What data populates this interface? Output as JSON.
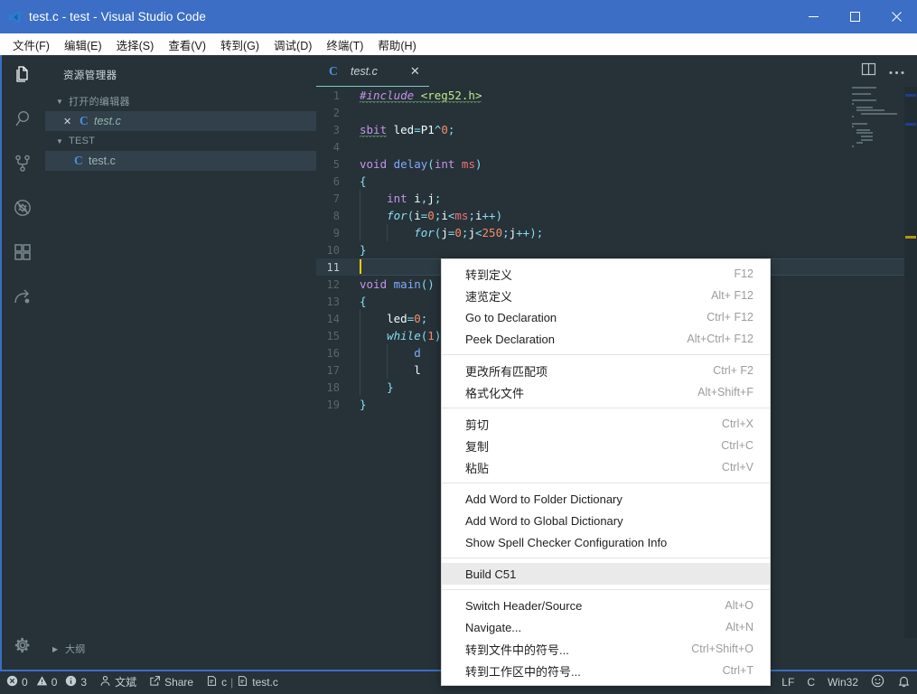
{
  "window": {
    "title": "test.c - test - Visual Studio Code",
    "icon": "vscode-logo-icon",
    "minimize_label": "–",
    "maximize_label": "□",
    "close_label": "✕"
  },
  "menubar": {
    "items": [
      {
        "label": "文件(F)",
        "name": "menubar-item-file"
      },
      {
        "label": "编辑(E)",
        "name": "menubar-item-edit"
      },
      {
        "label": "选择(S)",
        "name": "menubar-item-selection"
      },
      {
        "label": "查看(V)",
        "name": "menubar-item-view"
      },
      {
        "label": "转到(G)",
        "name": "menubar-item-go"
      },
      {
        "label": "调试(D)",
        "name": "menubar-item-debug"
      },
      {
        "label": "终端(T)",
        "name": "menubar-item-terminal"
      },
      {
        "label": "帮助(H)",
        "name": "menubar-item-help"
      }
    ]
  },
  "activitybar": {
    "items": [
      {
        "icon": "files-explorer-icon",
        "active": true
      },
      {
        "icon": "search-icon",
        "active": false
      },
      {
        "icon": "source-control-icon",
        "active": false
      },
      {
        "icon": "run-debug-icon",
        "active": false
      },
      {
        "icon": "extensions-icon",
        "active": false
      },
      {
        "icon": "remote-share-icon",
        "active": false
      }
    ],
    "settings_icon": "gear-icon"
  },
  "sidebar": {
    "title": "资源管理器",
    "open_editors": {
      "label": "打开的编辑器",
      "items": [
        {
          "name": "test.c",
          "badge": "C",
          "close": "✕"
        }
      ]
    },
    "folder": {
      "label": "TEST",
      "items": [
        {
          "name": "test.c",
          "badge": "C"
        }
      ]
    },
    "outline": {
      "label": "大纲"
    }
  },
  "editor": {
    "tab": {
      "label": "test.c",
      "badge": "C",
      "close": "✕"
    },
    "actions": {
      "split_icon": "split-editor-icon",
      "more_icon": "more-actions-icon"
    },
    "lines": [
      {
        "n": "1",
        "tokens": [
          {
            "t": "#include ",
            "c": "k-pre squig"
          },
          {
            "t": "<reg52.h>",
            "c": "k-str squig"
          }
        ]
      },
      {
        "n": "2",
        "tokens": []
      },
      {
        "n": "3",
        "tokens": [
          {
            "t": "sbit",
            "c": "k-type squig"
          },
          {
            "t": " led",
            "c": "k-id"
          },
          {
            "t": "=",
            "c": "k-op"
          },
          {
            "t": "P1",
            "c": "k-id"
          },
          {
            "t": "^",
            "c": "k-op"
          },
          {
            "t": "0",
            "c": "k-num"
          },
          {
            "t": ";",
            "c": "k-punc"
          }
        ]
      },
      {
        "n": "4",
        "tokens": []
      },
      {
        "n": "5",
        "tokens": [
          {
            "t": "void",
            "c": "k-type"
          },
          {
            "t": " ",
            "c": "k-id"
          },
          {
            "t": "delay",
            "c": "k-fn"
          },
          {
            "t": "(",
            "c": "k-punc"
          },
          {
            "t": "int",
            "c": "k-type"
          },
          {
            "t": " ms",
            "c": "k-param"
          },
          {
            "t": ")",
            "c": "k-punc"
          }
        ]
      },
      {
        "n": "6",
        "tokens": [
          {
            "t": "{",
            "c": "k-punc"
          }
        ]
      },
      {
        "n": "7",
        "tokens": [
          {
            "t": "    ",
            "c": "k-id"
          },
          {
            "t": "int",
            "c": "k-type"
          },
          {
            "t": " i",
            "c": "k-id"
          },
          {
            "t": ",",
            "c": "k-punc"
          },
          {
            "t": "j",
            "c": "k-id"
          },
          {
            "t": ";",
            "c": "k-punc"
          }
        ]
      },
      {
        "n": "8",
        "tokens": [
          {
            "t": "    ",
            "c": "k-id"
          },
          {
            "t": "for",
            "c": "k-ctrl"
          },
          {
            "t": "(",
            "c": "k-punc"
          },
          {
            "t": "i",
            "c": "k-id"
          },
          {
            "t": "=",
            "c": "k-op"
          },
          {
            "t": "0",
            "c": "k-num"
          },
          {
            "t": ";",
            "c": "k-punc"
          },
          {
            "t": "i",
            "c": "k-id"
          },
          {
            "t": "<",
            "c": "k-op"
          },
          {
            "t": "ms",
            "c": "k-param"
          },
          {
            "t": ";",
            "c": "k-punc"
          },
          {
            "t": "i",
            "c": "k-id"
          },
          {
            "t": "++",
            "c": "k-op"
          },
          {
            "t": ")",
            "c": "k-punc"
          }
        ]
      },
      {
        "n": "9",
        "tokens": [
          {
            "t": "        ",
            "c": "k-id"
          },
          {
            "t": "for",
            "c": "k-ctrl"
          },
          {
            "t": "(",
            "c": "k-punc"
          },
          {
            "t": "j",
            "c": "k-id"
          },
          {
            "t": "=",
            "c": "k-op"
          },
          {
            "t": "0",
            "c": "k-num"
          },
          {
            "t": ";",
            "c": "k-punc"
          },
          {
            "t": "j",
            "c": "k-id"
          },
          {
            "t": "<",
            "c": "k-op"
          },
          {
            "t": "250",
            "c": "k-num"
          },
          {
            "t": ";",
            "c": "k-punc"
          },
          {
            "t": "j",
            "c": "k-id"
          },
          {
            "t": "++",
            "c": "k-op"
          },
          {
            "t": ");",
            "c": "k-punc"
          }
        ]
      },
      {
        "n": "10",
        "tokens": [
          {
            "t": "}",
            "c": "k-punc"
          }
        ]
      },
      {
        "n": "11",
        "tokens": [],
        "current": true
      },
      {
        "n": "12",
        "tokens": [
          {
            "t": "void",
            "c": "k-type"
          },
          {
            "t": " ",
            "c": "k-id"
          },
          {
            "t": "main",
            "c": "k-fn"
          },
          {
            "t": "()",
            "c": "k-punc"
          }
        ]
      },
      {
        "n": "13",
        "tokens": [
          {
            "t": "{",
            "c": "k-punc"
          }
        ]
      },
      {
        "n": "14",
        "tokens": [
          {
            "t": "    ",
            "c": "k-id"
          },
          {
            "t": "led",
            "c": "k-id"
          },
          {
            "t": "=",
            "c": "k-op"
          },
          {
            "t": "0",
            "c": "k-num"
          },
          {
            "t": ";",
            "c": "k-punc"
          }
        ]
      },
      {
        "n": "15",
        "tokens": [
          {
            "t": "    ",
            "c": "k-id"
          },
          {
            "t": "while",
            "c": "k-ctrl"
          },
          {
            "t": "(",
            "c": "k-punc"
          },
          {
            "t": "1",
            "c": "k-num"
          },
          {
            "t": ")",
            "c": "k-punc"
          }
        ]
      },
      {
        "n": "16",
        "tokens": [
          {
            "t": "        ",
            "c": "k-id"
          },
          {
            "t": "d",
            "c": "k-fn"
          }
        ]
      },
      {
        "n": "17",
        "tokens": [
          {
            "t": "        ",
            "c": "k-id"
          },
          {
            "t": "l",
            "c": "k-id"
          }
        ]
      },
      {
        "n": "18",
        "tokens": [
          {
            "t": "    ",
            "c": "k-id"
          },
          {
            "t": "}",
            "c": "k-punc"
          }
        ]
      },
      {
        "n": "19",
        "tokens": [
          {
            "t": "}",
            "c": "k-punc"
          }
        ]
      }
    ]
  },
  "context_menu": {
    "groups": [
      {
        "items": [
          {
            "label": "转到定义",
            "key": "F12"
          },
          {
            "label": "速览定义",
            "key": "Alt+ F12"
          },
          {
            "label": "Go to Declaration",
            "key": "Ctrl+ F12"
          },
          {
            "label": "Peek Declaration",
            "key": "Alt+Ctrl+ F12"
          }
        ]
      },
      {
        "items": [
          {
            "label": "更改所有匹配项",
            "key": "Ctrl+ F2"
          },
          {
            "label": "格式化文件",
            "key": "Alt+Shift+F"
          }
        ]
      },
      {
        "items": [
          {
            "label": "剪切",
            "key": "Ctrl+X"
          },
          {
            "label": "复制",
            "key": "Ctrl+C"
          },
          {
            "label": "粘贴",
            "key": "Ctrl+V"
          }
        ]
      },
      {
        "items": [
          {
            "label": "Add Word to Folder Dictionary",
            "key": ""
          },
          {
            "label": "Add Word to Global Dictionary",
            "key": ""
          },
          {
            "label": "Show Spell Checker Configuration Info",
            "key": ""
          }
        ]
      },
      {
        "items": [
          {
            "label": "Build C51",
            "key": "",
            "highlight": true
          }
        ]
      },
      {
        "items": [
          {
            "label": "Switch Header/Source",
            "key": "Alt+O"
          },
          {
            "label": "Navigate...",
            "key": "Alt+N"
          },
          {
            "label": "转到文件中的符号...",
            "key": "Ctrl+Shift+O"
          },
          {
            "label": "转到工作区中的符号...",
            "key": "Ctrl+T"
          }
        ]
      }
    ]
  },
  "statusbar": {
    "errors": "0",
    "warnings": "0",
    "infos": "3",
    "user": "文斌",
    "share": "Share",
    "breadcrumb_lang": "c",
    "breadcrumb_sep": "|",
    "breadcrumb_file": "test.c",
    "eol": "LF",
    "language": "C",
    "platform": "Win32",
    "feedback_icon": "smiley-icon",
    "bell_icon": "bell-icon"
  },
  "colors": {
    "accent": "#3b6ec4",
    "editor_bg": "#263238",
    "tab_active_border": "#80cbc4",
    "cursor": "#ffcc00",
    "menu_bg": "#ffffff"
  }
}
